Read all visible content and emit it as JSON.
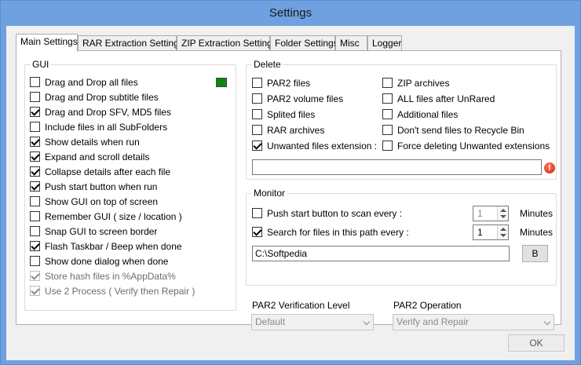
{
  "window": {
    "title": "Settings"
  },
  "tabs": [
    {
      "label": "Main Settings",
      "active": true
    },
    {
      "label": "RAR Extraction Settings"
    },
    {
      "label": "ZIP Extraction Settings"
    },
    {
      "label": "Folder Settings"
    },
    {
      "label": "Misc"
    },
    {
      "label": "Logger"
    }
  ],
  "gui": {
    "title": "GUI",
    "items": [
      {
        "label": "Drag and Drop all files",
        "checked": false
      },
      {
        "label": "Drag and Drop subtitle files",
        "checked": false
      },
      {
        "label": "Drag and Drop SFV, MD5 files",
        "checked": true
      },
      {
        "label": "Include files in all SubFolders",
        "checked": false
      },
      {
        "label": "Show details when run",
        "checked": true
      },
      {
        "label": "Expand and scroll details",
        "checked": true
      },
      {
        "label": "Collapse details after each file",
        "checked": true
      },
      {
        "label": "Push start button when run",
        "checked": true
      },
      {
        "label": "Show GUI on top of screen",
        "checked": false
      },
      {
        "label": "Remember GUI ( size / location )",
        "checked": false
      },
      {
        "label": "Snap GUI to screen border",
        "checked": false
      },
      {
        "label": "Flash Taskbar / Beep when done",
        "checked": true
      },
      {
        "label": "Show done dialog when done",
        "checked": false
      },
      {
        "label": "Store hash files in %AppData%",
        "checked": true,
        "disabled": true
      },
      {
        "label": "Use 2 Process ( Verify then Repair )",
        "checked": true,
        "disabled": true
      }
    ],
    "color_swatch": "#0a8a0a"
  },
  "delete": {
    "title": "Delete",
    "left": [
      {
        "label": "PAR2 files",
        "checked": false
      },
      {
        "label": "PAR2 volume files",
        "checked": false
      },
      {
        "label": "Splited files",
        "checked": false
      },
      {
        "label": "RAR archives",
        "checked": false
      },
      {
        "label": "Unwanted files extension :",
        "checked": true
      }
    ],
    "right": [
      {
        "label": "ZIP archives",
        "checked": false
      },
      {
        "label": "ALL files after UnRared",
        "checked": false
      },
      {
        "label": "Additional files",
        "checked": false
      },
      {
        "label": "Don't send files to Recycle Bin",
        "checked": false
      },
      {
        "label": "Force deleting Unwanted extensions",
        "checked": false
      }
    ],
    "extension_value": ""
  },
  "monitor": {
    "title": "Monitor",
    "push_start_label": "Push start button to scan every :",
    "push_start_checked": false,
    "push_start_value": "1",
    "search_label": "Search for files in this path every :",
    "search_checked": true,
    "search_value": "1",
    "minutes_label": "Minutes",
    "path_value": "C:\\Softpedia",
    "browse_label": "B"
  },
  "par2_verification": {
    "title": "PAR2 Verification Level",
    "selected": "Default"
  },
  "par2_operation": {
    "title": "PAR2 Operation",
    "selected": "Verify and Repair"
  },
  "ok_label": "OK",
  "colors": {
    "titlebar": "#6fa0e0",
    "accent_green": "#0a8a0a",
    "error_red": "#d4200f"
  }
}
